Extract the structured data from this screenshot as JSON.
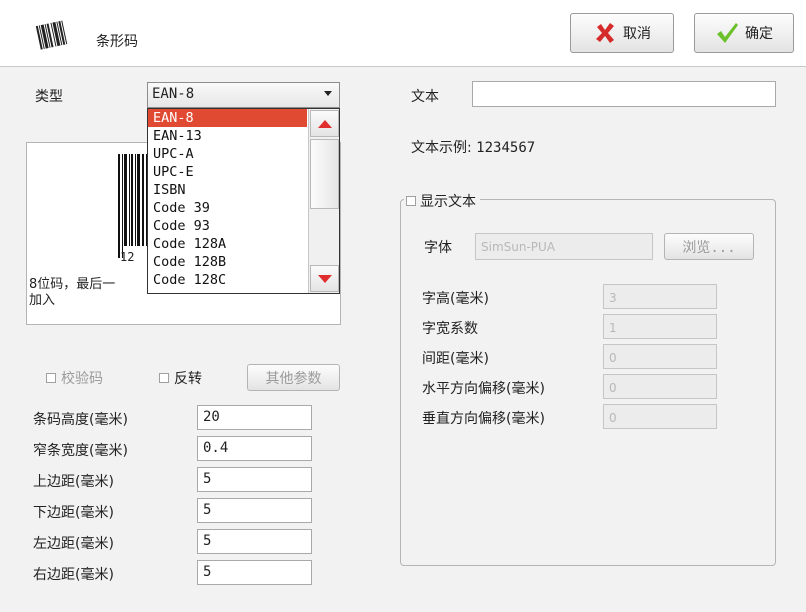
{
  "header": {
    "title": "条形码",
    "icon": "barcode-icon",
    "cancel_label": "取消",
    "cancel_icon": "red-x-icon",
    "ok_label": "确定",
    "ok_icon": "green-check-icon"
  },
  "barcode": {
    "type_label": "类型",
    "type_value": "EAN-8",
    "options": [
      "EAN-8",
      "EAN-13",
      "UPC-A",
      "UPC-E",
      "ISBN",
      "Code 39",
      "Code 93",
      "Code 128A",
      "Code 128B",
      "Code 128C"
    ],
    "selected_index": 0,
    "preview_number": "12",
    "preview_desc_line1": "8位码，最后一",
    "preview_desc_line2": "加入",
    "checksum_label": "校验码",
    "invert_label": "反转",
    "other_params_label": "其他参数",
    "fields": [
      {
        "label": "条码高度(毫米)",
        "value": "20"
      },
      {
        "label": "窄条宽度(毫米)",
        "value": "0.4"
      },
      {
        "label": "上边距(毫米)",
        "value": "5"
      },
      {
        "label": "下边距(毫米)",
        "value": "5"
      },
      {
        "label": "左边距(毫米)",
        "value": "5"
      },
      {
        "label": "右边距(毫米)",
        "value": "5"
      }
    ]
  },
  "text": {
    "label": "文本",
    "value": "",
    "example_label": "文本示例:",
    "example_value": "1234567",
    "show_text_label": "显示文本",
    "font_label": "字体",
    "font_value": "SimSun-PUA",
    "browse_label": "浏览...",
    "fields": [
      {
        "label": "字高(毫米)",
        "value": "3"
      },
      {
        "label": "字宽系数",
        "value": "1"
      },
      {
        "label": "间距(毫米)",
        "value": "0"
      },
      {
        "label": "水平方向偏移(毫米)",
        "value": "0"
      },
      {
        "label": "垂直方向偏移(毫米)",
        "value": "0"
      }
    ]
  },
  "colors": {
    "selected_item": "#e04a32",
    "scroll_arrow": "#e02d2d",
    "cancel_icon": "#d62b2b",
    "ok_icon": "#6cc12b"
  }
}
